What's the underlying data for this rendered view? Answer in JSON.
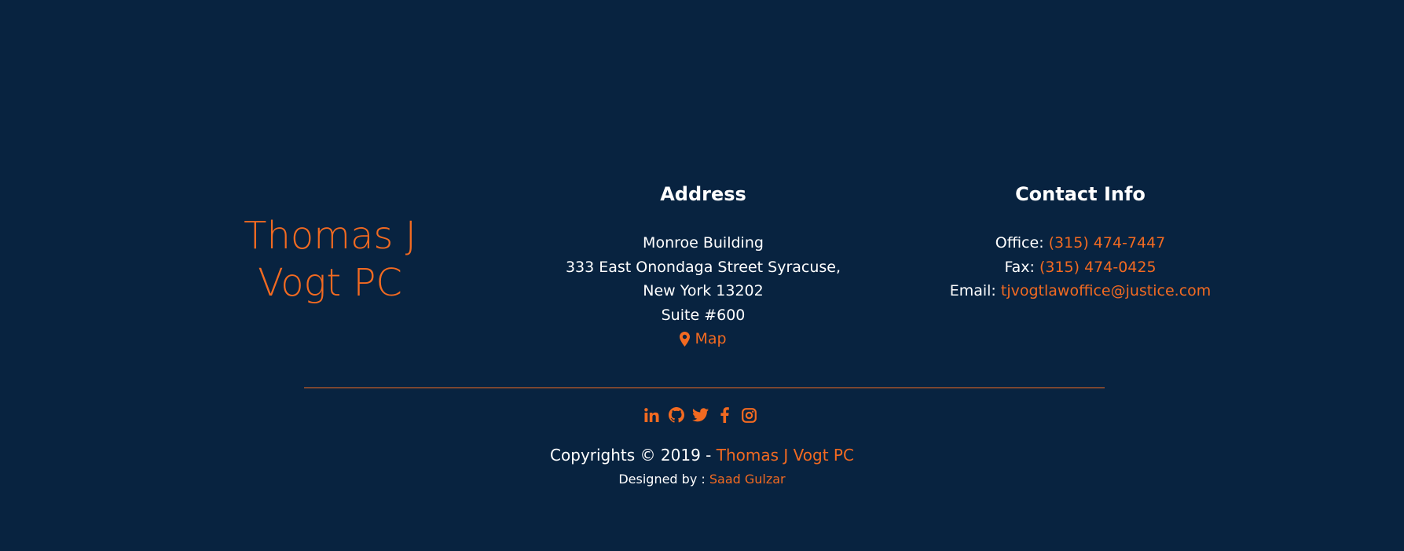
{
  "brand": {
    "line1": "Thomas J",
    "line2": "Vogt PC"
  },
  "address": {
    "heading": "Address",
    "building": "Monroe Building",
    "street": "333 East Onondaga Street Syracuse,",
    "city": "New York 13202",
    "suite": "Suite #600",
    "map_label": "Map"
  },
  "contact": {
    "heading": "Contact Info",
    "office_label": "Office: ",
    "office_value": "(315) 474-7447",
    "fax_label": "Fax: ",
    "fax_value": "(315) 474-0425",
    "email_label": "Email: ",
    "email_value": "tjvogtlawoffice@justice.com"
  },
  "social": [
    {
      "icon": "linkedin-icon"
    },
    {
      "icon": "github-icon"
    },
    {
      "icon": "twitter-icon"
    },
    {
      "icon": "facebook-icon"
    },
    {
      "icon": "instagram-icon"
    }
  ],
  "copyright": {
    "prefix": "Copyrights © 2019 - ",
    "owner": "Thomas J Vogt PC"
  },
  "designed": {
    "prefix": "Designed by : ",
    "designer": "Saad Gulzar"
  },
  "colors": {
    "background": "#082340",
    "accent": "#f26a21",
    "text": "#ffffff"
  }
}
